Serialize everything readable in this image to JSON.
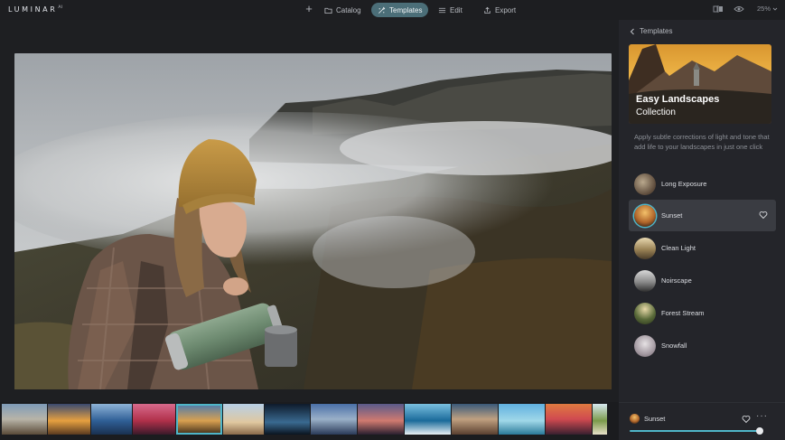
{
  "app": {
    "name": "LUMINAR",
    "version": "AI"
  },
  "toolbar": {
    "add_label": "+",
    "tabs": [
      {
        "label": "Catalog",
        "icon": "folder-icon"
      },
      {
        "label": "Templates",
        "icon": "templates-icon",
        "active": true
      },
      {
        "label": "Edit",
        "icon": "sliders-icon"
      },
      {
        "label": "Export",
        "icon": "share-icon"
      }
    ],
    "zoom": "25%"
  },
  "panel": {
    "back_label": "Templates",
    "collection": {
      "title": "Easy Landscapes",
      "subtitle": "Collection"
    },
    "description": "Apply subtle corrections of light and tone that add life to your landscapes in just one click",
    "templates": [
      {
        "label": "Long Exposure"
      },
      {
        "label": "Sunset",
        "active": true
      },
      {
        "label": "Clean Light"
      },
      {
        "label": "Noirscape"
      },
      {
        "label": "Forest Stream"
      },
      {
        "label": "Snowfall"
      }
    ]
  },
  "applied": {
    "label": "Sunset",
    "more": "···",
    "amount": 1.0
  },
  "colors": {
    "accent": "#4fb6c9",
    "active_tab": "#4b6e78",
    "panel": "#24252a",
    "background": "#1e1f22"
  }
}
